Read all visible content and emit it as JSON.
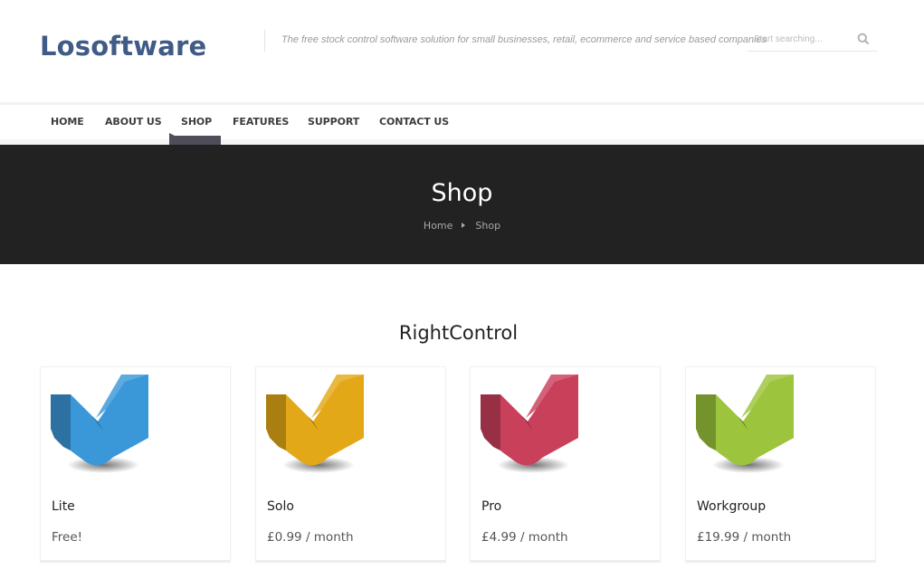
{
  "header": {
    "logo": "Losoftware",
    "tagline": "The free stock control software solution for small businesses, retail, ecommerce and service based companies",
    "search": {
      "placeholder": "Start searching...",
      "value": "",
      "icon": "search-icon"
    }
  },
  "nav": {
    "items": [
      {
        "label": "HOME",
        "active": false
      },
      {
        "label": "ABOUT US",
        "active": false
      },
      {
        "label": "SHOP",
        "active": true
      },
      {
        "label": "FEATURES",
        "active": false
      },
      {
        "label": "SUPPORT",
        "active": false
      },
      {
        "label": "CONTACT US",
        "active": false
      }
    ]
  },
  "banner": {
    "title": "Shop",
    "breadcrumb": [
      "Home",
      "Shop"
    ]
  },
  "section": {
    "title": "RightControl",
    "products": [
      {
        "name": "Lite",
        "price": "Free!",
        "icon": "checkmark-icon",
        "color": "#3a97d8"
      },
      {
        "name": "Solo",
        "price": "£0.99 / month",
        "icon": "checkmark-icon",
        "color": "#e3a817"
      },
      {
        "name": "Pro",
        "price": "£4.99 / month",
        "icon": "checkmark-icon",
        "color": "#c9405a"
      },
      {
        "name": "Workgroup",
        "price": "£19.99 / month",
        "icon": "checkmark-icon",
        "color": "#9cc43c"
      }
    ]
  },
  "colors": {
    "logo": "#3f5b86",
    "banner_bg": "#222222",
    "nav_indicator": "#4f4d5a"
  }
}
